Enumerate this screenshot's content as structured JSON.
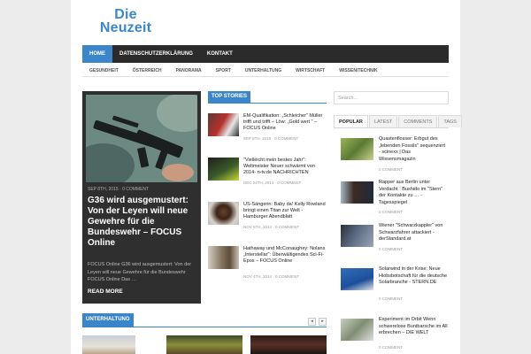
{
  "logo": {
    "line1": "Die",
    "line2": "Neuzeit"
  },
  "main_nav": [
    {
      "label": "HOME",
      "active": true
    },
    {
      "label": "DATENSCHUTZERKLÄRUNG",
      "active": false
    },
    {
      "label": "KONTAKT",
      "active": false
    }
  ],
  "sub_nav": [
    "GESUNDHEIT",
    "ÖSTERREICH",
    "PANORAMA",
    "SPORT",
    "UNTERHALTUNG",
    "WIRTSCHAFT",
    "WISSEN/TECHNIK"
  ],
  "featured": {
    "date": "SEP 8TH, 2015 · 0 COMMENT",
    "title": "G36 wird ausgemustert: Von der Leyen will neue Gewehre für die Bundeswehr – FOCUS Online",
    "excerpt": "FOCUS Online G36 wird ausgemustert: Von der Leyen will neue Gewehre für die Bundeswehr FOCUS Online Das …",
    "read_more": "READ MORE"
  },
  "top_stories": {
    "heading": "TOP STORIES",
    "items": [
      {
        "title": "EM-Qualifikation: „Schleicher\" Müller trifft und trifft – Löw: „Gold wert \" – FOCUS Online",
        "meta": "SEP 8TH, 2015 · 0 COMMENT"
      },
      {
        "title": "\"Vielleicht mein bestes Jahr\": Weltmeister Neuer schwärmt von 2014- n-tv.de NACHRICHTEN",
        "meta": "DEC 24TH, 2014 · 0 COMMENT"
      },
      {
        "title": "US-Sängerin: Baby da! Kelly Rowland bringt einen Titan zur Welt - Hamburger Abendblatt",
        "meta": "NOV 5TH, 2014 · 0 COMMENT"
      },
      {
        "title": "Hathaway und McConaughey: Nolans „Interstellar\": Überwältigendes Sci-Fi-Epos – FOCUS Online",
        "meta": "NOV 4TH, 2014 · 0 COMMENT"
      }
    ]
  },
  "search": {
    "placeholder": "Search..."
  },
  "tabs": [
    {
      "label": "POPULAR",
      "active": true
    },
    {
      "label": "LATEST",
      "active": false
    },
    {
      "label": "COMMENTS",
      "active": false
    },
    {
      "label": "TAGS",
      "active": false
    }
  ],
  "popular": [
    {
      "title": "Quastenflosser: Erbgut des „lebenden Fossils\" sequenziert - scinexx | Das Wissensmagazin",
      "comments": "0 COMMENT"
    },
    {
      "title": "Rapper aus Berlin unter Verdacht : Bushido im \"Stern\" der Kontakte zu … - Tagesspiegel",
      "comments": "0 COMMENT"
    },
    {
      "title": "Wiener \"Schwarzkappler\" von Schwarzfahrer attackiert - derStandard.at",
      "comments": "0 COMMENT"
    },
    {
      "title": "Solarwind in der Krise: Neue Hiobsbotschaft für die deutsche Solarbranche - STERN.DE",
      "comments": "0 COMMENT"
    },
    {
      "title": "Experiment im Orbit Wenn schwerelose Buntbarsche im All erbrechen – DIE WELT",
      "comments": "0 COMMENT"
    }
  ],
  "bottom_section": {
    "heading": "UNTERHALTUNG",
    "prev": "◂",
    "next": "▸"
  },
  "colors": {
    "accent": "#3b86cb",
    "nav_bg": "#2b2b2b",
    "featured_bg": "#2f2f2f"
  }
}
